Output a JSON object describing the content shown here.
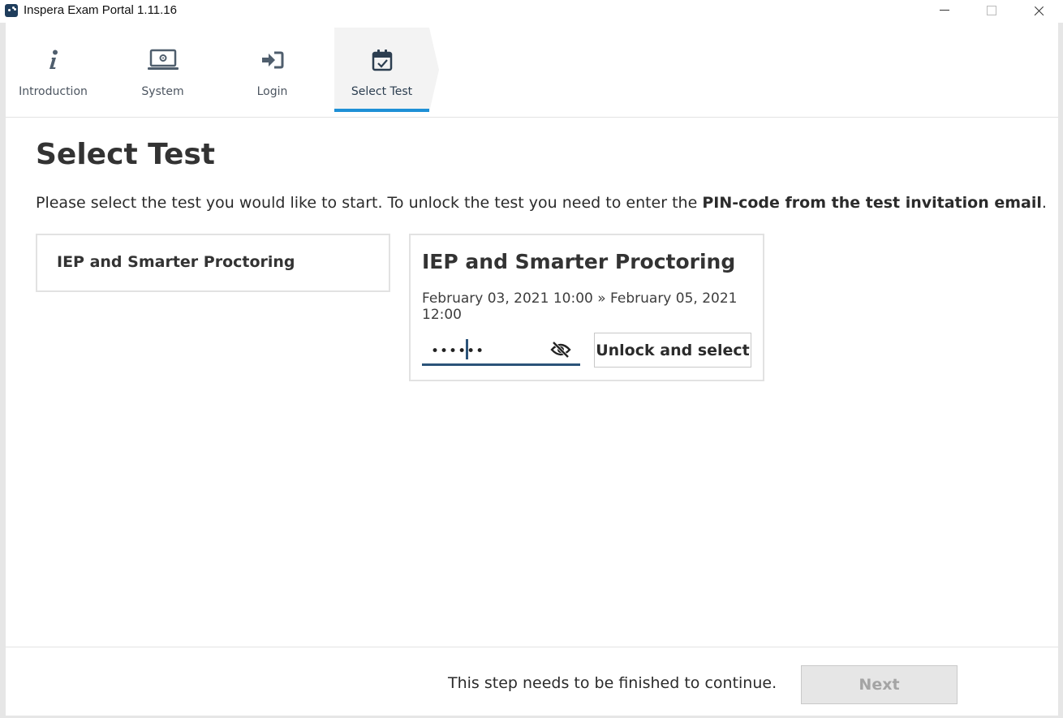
{
  "window": {
    "title": "Inspera Exam Portal 1.11.16"
  },
  "steps": [
    {
      "label": "Introduction",
      "icon": "info-icon",
      "active": false
    },
    {
      "label": "System",
      "icon": "laptop-gear-icon",
      "active": false
    },
    {
      "label": "Login",
      "icon": "sign-in-icon",
      "active": false
    },
    {
      "label": "Select Test",
      "icon": "calendar-check-icon",
      "active": true
    }
  ],
  "main": {
    "title": "Select Test",
    "instructions_prefix": "Please select the test you would like to start. To unlock the test you need to enter the ",
    "instructions_bold": "PIN-code from the test invitation email",
    "instructions_suffix": "."
  },
  "tests": [
    {
      "title": "IEP and Smarter Proctoring"
    }
  ],
  "selected_test": {
    "title": "IEP and Smarter Proctoring",
    "dates": "February 03, 2021 10:00 » February 05, 2021 12:00",
    "pin_value": "••••••",
    "unlock_label": "Unlock and select"
  },
  "footer": {
    "message": "This step needs to be finished to continue.",
    "next_label": "Next"
  },
  "colors": {
    "accent": "#1e90d6",
    "input_underline": "#2b5379",
    "disabled_button": "#e6e6e6"
  }
}
